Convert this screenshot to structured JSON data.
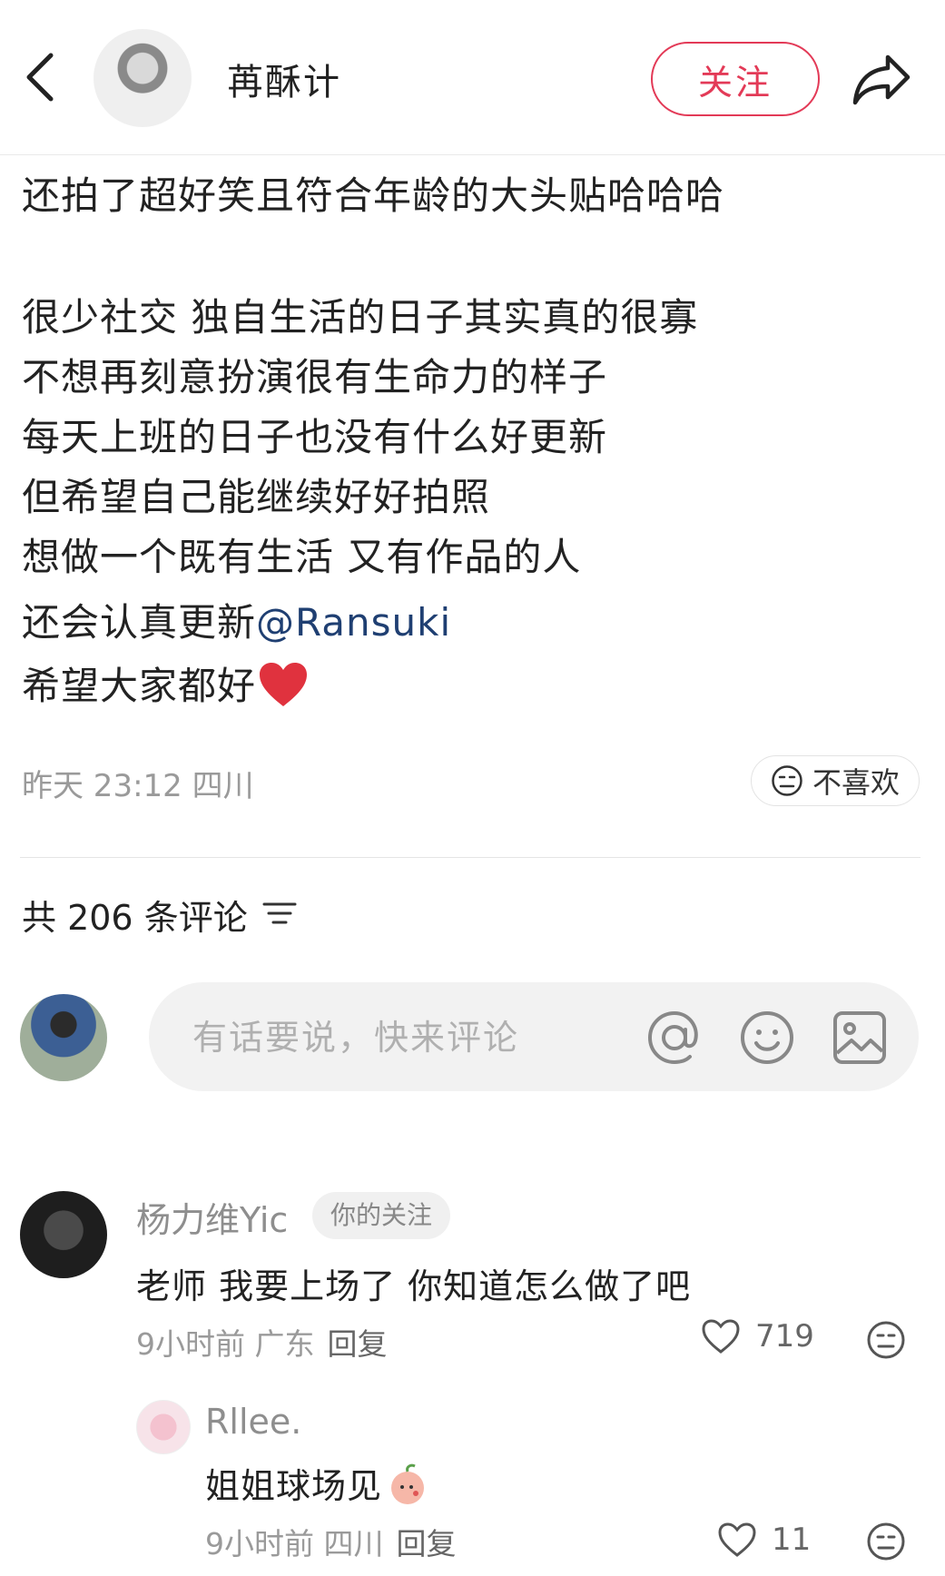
{
  "header": {
    "back_icon": "chevron-left-icon",
    "author_name": "苒酥计",
    "follow_label": "关注",
    "share_icon": "share-arrow-icon"
  },
  "post": {
    "lines": [
      "还拍了超好笑且符合年龄的大头贴哈哈哈",
      "很少社交 独自生活的日子其实真的很寡",
      "不想再刻意扮演很有生命力的样子",
      "每天上班的日子也没有什么好更新",
      "但希望自己能继续好好拍照",
      "想做一个既有生活 又有作品的人"
    ],
    "mention_prefix": "还会认真更新",
    "mention": "@Ransuki",
    "last_line": "希望大家都好",
    "meta": "昨天 23:12 四川",
    "dislike_label": "不喜欢"
  },
  "comments_section": {
    "count_label": "共 206 条评论",
    "input_placeholder": "有话要说，快来评论",
    "icons": [
      "at-icon",
      "emoji-icon",
      "image-icon"
    ]
  },
  "comments": [
    {
      "user": "杨力维Yic",
      "badge": "你的关注",
      "text": "老师 我要上场了 你知道怎么做了吧",
      "time_loc": "9小时前 广东",
      "reply_label": "回复",
      "likes": "719"
    },
    {
      "user": "Rllee.",
      "text": "姐姐球场见",
      "time_loc": "9小时前 四川",
      "reply_label": "回复",
      "likes": "11"
    }
  ],
  "colors": {
    "accent": "#e33a57",
    "mention": "#1f3f72",
    "muted": "#9a9a9a"
  }
}
